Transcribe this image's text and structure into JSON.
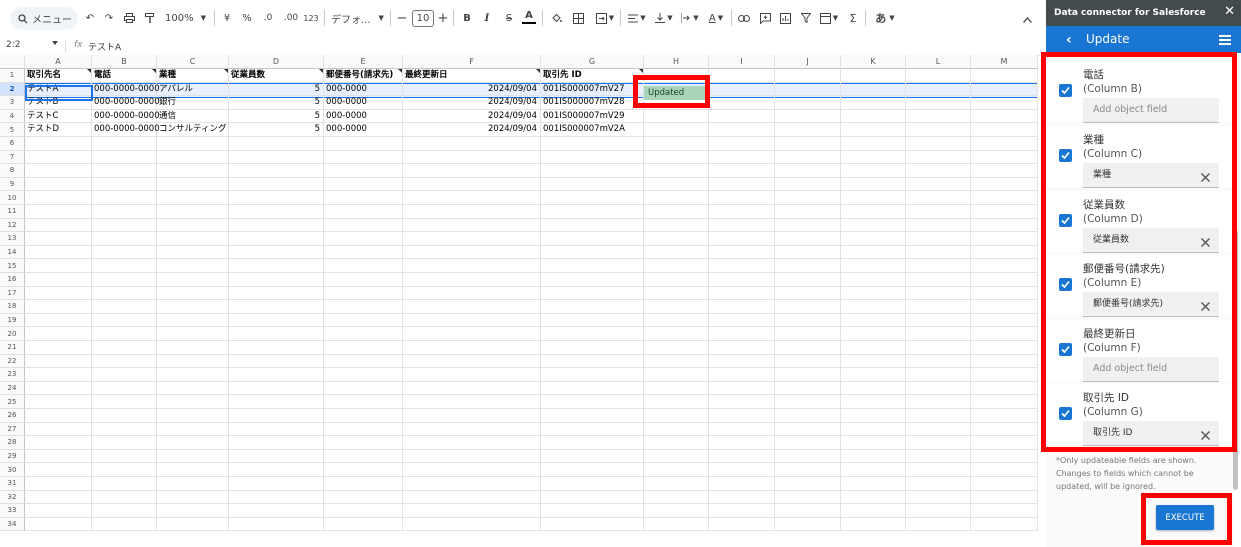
{
  "toolbar": {
    "menu_label": "メニュー",
    "zoom": "100%",
    "currency_symbol": "¥",
    "percent_symbol": "%",
    "decrease_decimal": ".0",
    "increase_decimal": ".00",
    "number_format": "123",
    "font_name": "デフォ...",
    "font_size": "10",
    "bold": "B",
    "italic": "I",
    "strike": "S",
    "text_color": "A",
    "sum": "Σ",
    "input_tool": "あ"
  },
  "formula_bar": {
    "cell_ref": "2:2",
    "fx": "fx",
    "content": "テストA"
  },
  "grid": {
    "columns": [
      "A",
      "B",
      "C",
      "D",
      "E",
      "F",
      "G",
      "H",
      "I",
      "J",
      "K",
      "L",
      "M"
    ],
    "rows": [
      "1",
      "2",
      "3",
      "4",
      "5",
      "6",
      "7",
      "8",
      "9",
      "10",
      "11",
      "12",
      "13",
      "14",
      "15",
      "16",
      "17",
      "18",
      "19",
      "20",
      "21",
      "22",
      "23",
      "24",
      "25",
      "26",
      "27",
      "28",
      "29",
      "30",
      "31",
      "32",
      "33",
      "34"
    ],
    "header_row": [
      "取引先名",
      "電話",
      "業種",
      "従業員数",
      "郵便番号(請求先)",
      "最終更新日",
      "取引先 ID"
    ],
    "data_rows": [
      [
        "テストA",
        "000-0000-0000",
        "アパレル",
        "5",
        "000-0000",
        "2024/09/04",
        "001IS000007mV27"
      ],
      [
        "テストB",
        "000-0000-0000",
        "銀行",
        "5",
        "000-0000",
        "2024/09/04",
        "001IS000007mV28"
      ],
      [
        "テストC",
        "000-0000-0000",
        "通信",
        "5",
        "000-0000",
        "2024/09/04",
        "001IS000007mV29"
      ],
      [
        "テストD",
        "000-0000-0000",
        "コンサルティング",
        "5",
        "000-0000",
        "2024/09/04",
        "001IS000007mV2A"
      ]
    ],
    "h2_value": "Updated",
    "h2_color": "#a8d5b8"
  },
  "panel": {
    "app_title": "Data connector for Salesforce",
    "close": "✕",
    "back": "‹",
    "title": "Update",
    "fields": [
      {
        "label": "電話",
        "column": "(Column B)",
        "value": "",
        "placeholder": "Add object field"
      },
      {
        "label": "業種",
        "column": "(Column C)",
        "value": "業種",
        "placeholder": ""
      },
      {
        "label": "従業員数",
        "column": "(Column D)",
        "value": "従業員数",
        "placeholder": ""
      },
      {
        "label": "郵便番号(請求先)",
        "column": "(Column E)",
        "value": "郵便番号(請求先)",
        "placeholder": ""
      },
      {
        "label": "最終更新日",
        "column": "(Column F)",
        "value": "",
        "placeholder": "Add object field"
      },
      {
        "label": "取引先 ID",
        "column": "(Column G)",
        "value": "取引先 ID",
        "placeholder": ""
      }
    ],
    "note": "*Only updateable fields are shown. Changes to fields which cannot be updated, will be ignored.",
    "execute_label": "EXECUTE",
    "accent_color": "#1976d2",
    "highlight_color": "#ff0000"
  }
}
